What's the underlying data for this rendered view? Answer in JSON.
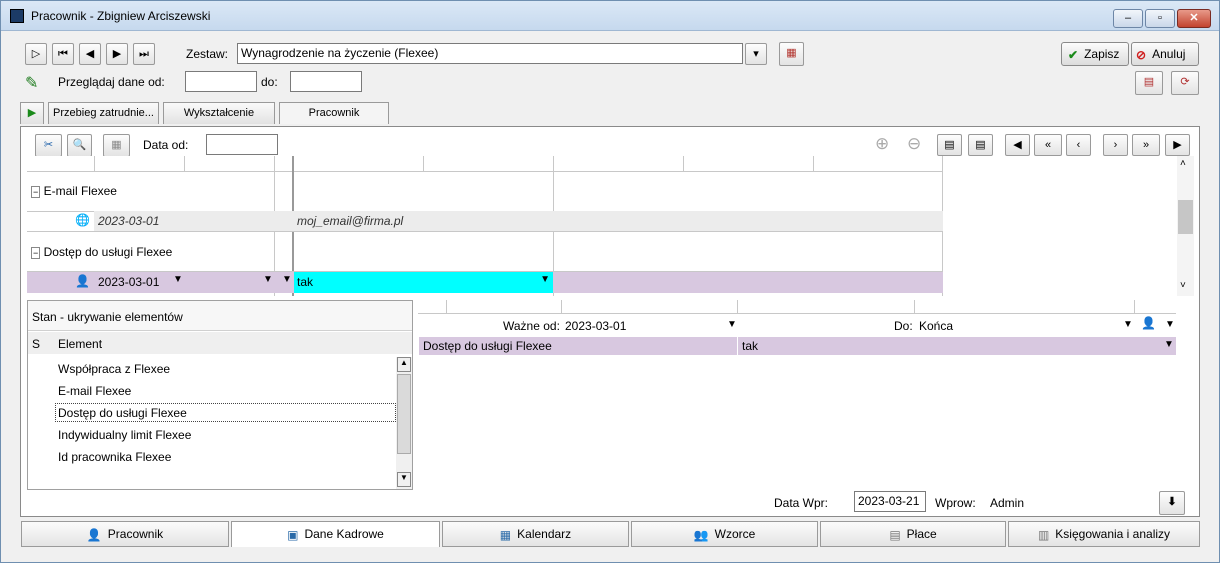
{
  "window": {
    "title": "Pracownik - Zbigniew Arciszewski"
  },
  "toolbar": {
    "zestaw_label": "Zestaw:",
    "zestaw_value": "Wynagrodzenie na życzenie (Flexee)",
    "browse_label": "Przeglądaj dane od:",
    "do_label": "do:",
    "save_label": "Zapisz",
    "cancel_label": "Anuluj"
  },
  "tabs": [
    "Przebieg zatrudnie...",
    "Wykształcenie",
    "Pracownik"
  ],
  "grid": {
    "data_od_label": "Data od:",
    "groups": [
      {
        "name": "E-mail Flexee",
        "date": "2023-03-01",
        "value": "moj_email@firma.pl"
      },
      {
        "name": "Dostęp do usługi Flexee",
        "date": "2023-03-01",
        "value": "tak"
      }
    ]
  },
  "state_panel": {
    "title": "Stan - ukrywanie elementów",
    "col_s": "S",
    "col_element": "Element",
    "items": [
      "Współpraca z Flexee",
      "E-mail Flexee",
      "Dostęp do usługi Flexee",
      "Indywidualny limit Flexee",
      "Id pracownika Flexee"
    ]
  },
  "detail": {
    "wazne_od_label": "Ważne od:",
    "wazne_od_value": "2023-03-01",
    "do_label": "Do:",
    "do_value": "Końca",
    "row_name": "Dostęp do usługi Flexee",
    "row_value": "tak"
  },
  "footer": {
    "data_wpr_label": "Data Wpr:",
    "data_wpr_value": "2023-03-21",
    "wprow_label": "Wprow:",
    "wprow_value": "Admin"
  },
  "bottom_tabs": [
    "Pracownik",
    "Dane Kadrowe",
    "Kalendarz",
    "Wzorce",
    "Płace",
    "Księgowania i analizy"
  ],
  "colors": {
    "selected_row": "#d8c8e0",
    "cyan_cell": "#00ffff"
  }
}
